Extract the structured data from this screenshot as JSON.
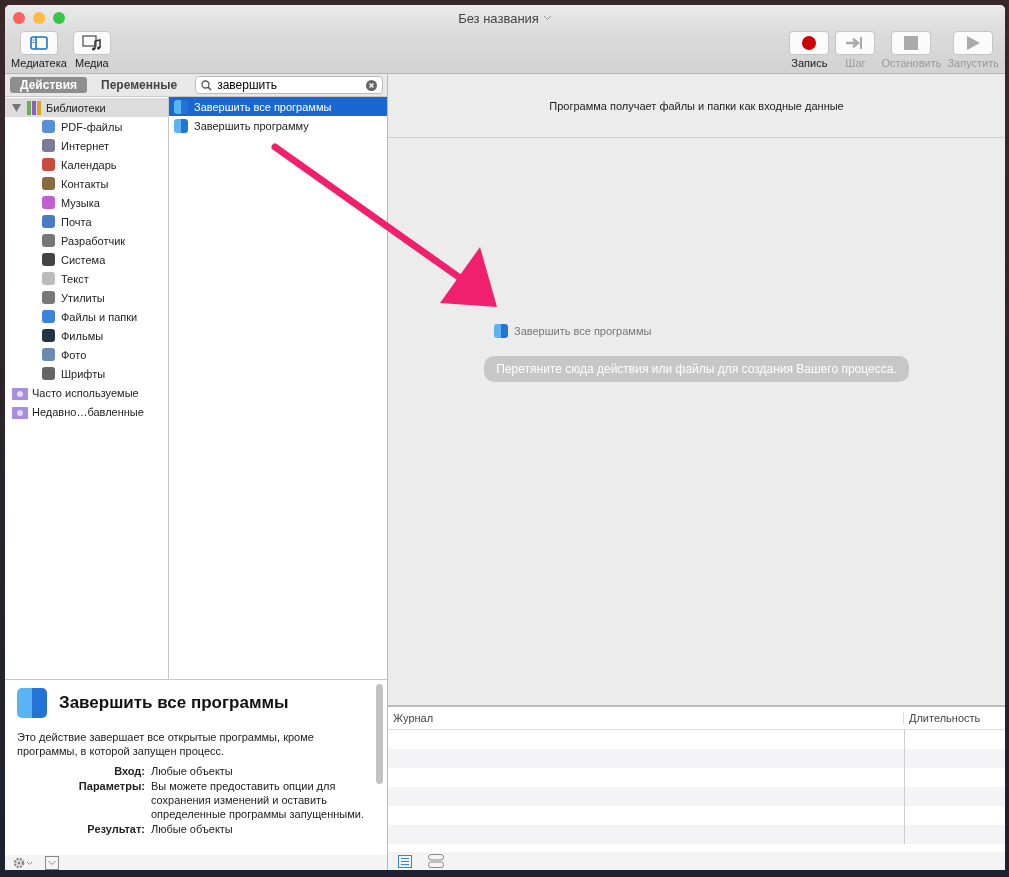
{
  "window": {
    "title": "Без названия"
  },
  "toolbar_left": [
    {
      "label": "Медиатека",
      "kind": "library"
    },
    {
      "label": "Медиа",
      "kind": "media"
    }
  ],
  "toolbar_right": [
    {
      "label": "Запись",
      "kind": "record",
      "disabled": false
    },
    {
      "label": "Шаг",
      "kind": "step",
      "disabled": true
    },
    {
      "label": "Остановить",
      "kind": "stop",
      "disabled": true
    },
    {
      "label": "Запустить",
      "kind": "run",
      "disabled": true
    }
  ],
  "tabs": [
    {
      "label": "Действия",
      "selected": true
    },
    {
      "label": "Переменные",
      "selected": false
    }
  ],
  "search": {
    "value": "завершить"
  },
  "library": [
    {
      "label": "Библиотеки",
      "expanded": true,
      "selected": true,
      "children": [
        {
          "label": "PDF-файлы",
          "selected": false
        },
        {
          "label": "Интернет",
          "selected": false
        },
        {
          "label": "Календарь",
          "selected": false
        },
        {
          "label": "Контакты",
          "selected": false
        },
        {
          "label": "Музыка",
          "selected": false
        },
        {
          "label": "Почта",
          "selected": false
        },
        {
          "label": "Разработчик",
          "selected": false
        },
        {
          "label": "Система",
          "selected": false
        },
        {
          "label": "Текст",
          "selected": false
        },
        {
          "label": "Утилиты",
          "selected": false
        },
        {
          "label": "Файлы и папки",
          "selected": false
        },
        {
          "label": "Фильмы",
          "selected": false
        },
        {
          "label": "Фото",
          "selected": false
        },
        {
          "label": "Шрифты",
          "selected": false
        }
      ]
    },
    {
      "label": "Часто используемые",
      "selected": false
    },
    {
      "label": "Недавно…бавленные",
      "selected": false
    }
  ],
  "actions": [
    {
      "label": "Завершить все программы",
      "selected": true
    },
    {
      "label": "Завершить программу",
      "selected": false
    }
  ],
  "description": {
    "title": "Завершить все программы",
    "text": "Это действие завершает все открытые программы, кроме программы, в которой запущен процесс.",
    "fields": [
      {
        "label": "Вход:",
        "value": "Любые объекты"
      },
      {
        "label": "Параметры:",
        "value": "Вы можете предоставить опции для сохранения изменений и оставить определенные программы запущенными."
      },
      {
        "label": "Результат:",
        "value": "Любые объекты"
      }
    ]
  },
  "workflow": {
    "header": "Программа получает файлы и папки как входные данные",
    "dragged_item": "Завершить все программы",
    "hint": "Перетяните сюда действия или файлы для создания Вашего процесса."
  },
  "log": {
    "columns": [
      "Журнал",
      "Длительность"
    ]
  }
}
